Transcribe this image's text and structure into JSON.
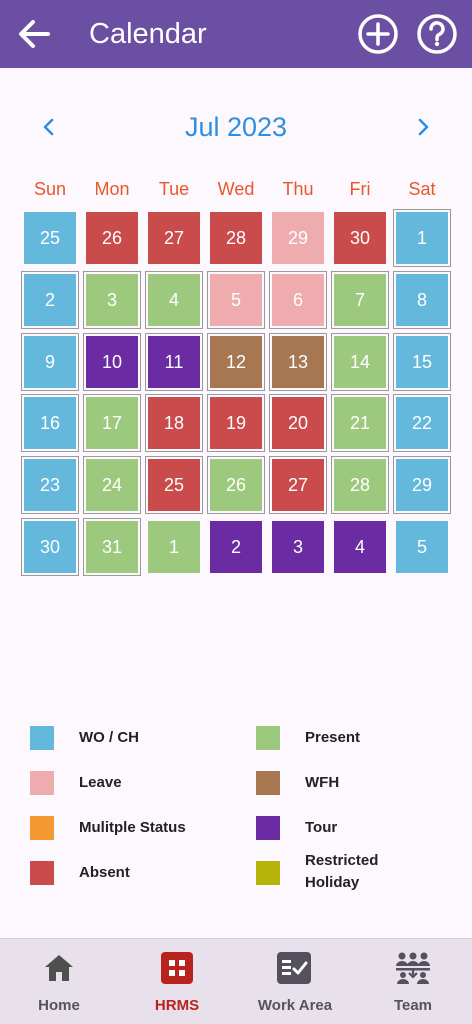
{
  "header": {
    "title": "Calendar",
    "back_icon": "arrow-left-icon",
    "add_icon": "plus-circle-icon",
    "help_icon": "help-circle-icon"
  },
  "month": {
    "label": "Jul 2023"
  },
  "weekdays": [
    "Sun",
    "Mon",
    "Tue",
    "Wed",
    "Thu",
    "Fri",
    "Sat"
  ],
  "colors": {
    "wo": "#63b8dc",
    "present": "#9cc97e",
    "leave": "#efacae",
    "wfh": "#a67751",
    "multi": "#f59a32",
    "tour": "#6b2ba3",
    "absent": "#c94b4c",
    "restricted": "#b8b50a",
    "accent": "#6a4fa3",
    "weekday": "#e8572a",
    "month": "#2f8ee0"
  },
  "calendar": {
    "weeks": [
      [
        {
          "d": "25",
          "s": "wo",
          "cur": false
        },
        {
          "d": "26",
          "s": "absent",
          "cur": false
        },
        {
          "d": "27",
          "s": "absent",
          "cur": false
        },
        {
          "d": "28",
          "s": "absent",
          "cur": false
        },
        {
          "d": "29",
          "s": "leave",
          "cur": false
        },
        {
          "d": "30",
          "s": "absent",
          "cur": false
        },
        {
          "d": "1",
          "s": "wo",
          "cur": true
        }
      ],
      [
        {
          "d": "2",
          "s": "wo",
          "cur": true
        },
        {
          "d": "3",
          "s": "present",
          "cur": true
        },
        {
          "d": "4",
          "s": "present",
          "cur": true
        },
        {
          "d": "5",
          "s": "leave",
          "cur": true
        },
        {
          "d": "6",
          "s": "leave",
          "cur": true
        },
        {
          "d": "7",
          "s": "present",
          "cur": true
        },
        {
          "d": "8",
          "s": "wo",
          "cur": true
        }
      ],
      [
        {
          "d": "9",
          "s": "wo",
          "cur": true
        },
        {
          "d": "10",
          "s": "tour",
          "cur": true
        },
        {
          "d": "11",
          "s": "tour",
          "cur": true
        },
        {
          "d": "12",
          "s": "wfh",
          "cur": true
        },
        {
          "d": "13",
          "s": "wfh",
          "cur": true
        },
        {
          "d": "14",
          "s": "present",
          "cur": true
        },
        {
          "d": "15",
          "s": "wo",
          "cur": true
        }
      ],
      [
        {
          "d": "16",
          "s": "wo",
          "cur": true
        },
        {
          "d": "17",
          "s": "present",
          "cur": true
        },
        {
          "d": "18",
          "s": "absent",
          "cur": true
        },
        {
          "d": "19",
          "s": "absent",
          "cur": true
        },
        {
          "d": "20",
          "s": "absent",
          "cur": true
        },
        {
          "d": "21",
          "s": "present",
          "cur": true
        },
        {
          "d": "22",
          "s": "wo",
          "cur": true
        }
      ],
      [
        {
          "d": "23",
          "s": "wo",
          "cur": true
        },
        {
          "d": "24",
          "s": "present",
          "cur": true
        },
        {
          "d": "25",
          "s": "absent",
          "cur": true
        },
        {
          "d": "26",
          "s": "present",
          "cur": true
        },
        {
          "d": "27",
          "s": "absent",
          "cur": true
        },
        {
          "d": "28",
          "s": "present",
          "cur": true
        },
        {
          "d": "29",
          "s": "wo",
          "cur": true
        }
      ],
      [
        {
          "d": "30",
          "s": "wo",
          "cur": true
        },
        {
          "d": "31",
          "s": "present",
          "cur": true
        },
        {
          "d": "1",
          "s": "present",
          "cur": false
        },
        {
          "d": "2",
          "s": "tour",
          "cur": false
        },
        {
          "d": "3",
          "s": "tour",
          "cur": false
        },
        {
          "d": "4",
          "s": "tour",
          "cur": false
        },
        {
          "d": "5",
          "s": "wo",
          "cur": false
        }
      ]
    ]
  },
  "legend": [
    {
      "label": "WO / CH",
      "color": "wo"
    },
    {
      "label": "Present",
      "color": "present"
    },
    {
      "label": "Leave",
      "color": "leave"
    },
    {
      "label": "WFH",
      "color": "wfh"
    },
    {
      "label": "Mulitple Status",
      "color": "multi"
    },
    {
      "label": "Tour",
      "color": "tour"
    },
    {
      "label": "Absent",
      "color": "absent"
    },
    {
      "label": "Restricted Holiday",
      "color": "restricted"
    }
  ],
  "bottom_nav": [
    {
      "label": "Home",
      "icon": "home-icon",
      "active": false
    },
    {
      "label": "HRMS",
      "icon": "hrms-grid-icon",
      "active": true
    },
    {
      "label": "Work Area",
      "icon": "work-area-icon",
      "active": false
    },
    {
      "label": "Team",
      "icon": "team-icon",
      "active": false
    }
  ]
}
